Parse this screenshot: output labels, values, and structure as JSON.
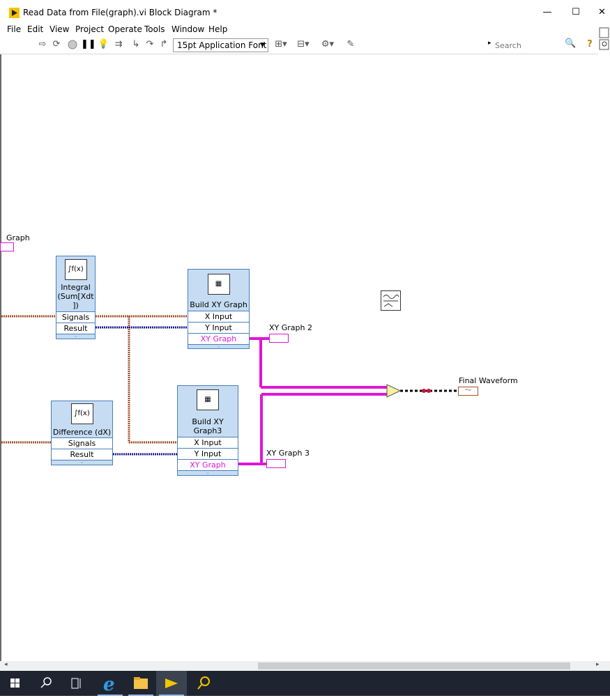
{
  "window": {
    "title": "Read Data from File(graph).vi Block Diagram *",
    "minimize": "—",
    "maximize": "☐",
    "close": "✕"
  },
  "menu": [
    "File",
    "Edit",
    "View",
    "Project",
    "Operate",
    "Tools",
    "Window",
    "Help"
  ],
  "toolbar": {
    "font": "15pt Application Font",
    "search_placeholder": "Search"
  },
  "diagram": {
    "graph_label": "Graph",
    "integral": {
      "title": "Integral (Sum[Xdt])",
      "line1": "Integral",
      "line2": "(Sum[Xdt",
      "line3": "])",
      "signals": "Signals",
      "result": "Result"
    },
    "difference": {
      "title": "Difference (dX)",
      "signals": "Signals",
      "result": "Result"
    },
    "build_xy_1": {
      "title": "Build XY Graph",
      "x_input": "X Input",
      "y_input": "Y Input",
      "output": "XY Graph"
    },
    "build_xy_2": {
      "line1": "Build XY",
      "line2": "Graph3",
      "x_input": "X Input",
      "y_input": "Y Input",
      "output": "XY Graph"
    },
    "xy_graph_2": "XY Graph 2",
    "xy_graph_3": "XY Graph 3",
    "final_waveform": "Final Waveform"
  },
  "taskbar": [
    "start-icon",
    "search-icon",
    "task-view-icon",
    "ie-icon",
    "file-explorer-icon",
    "labview-icon",
    "search-app-icon"
  ]
}
